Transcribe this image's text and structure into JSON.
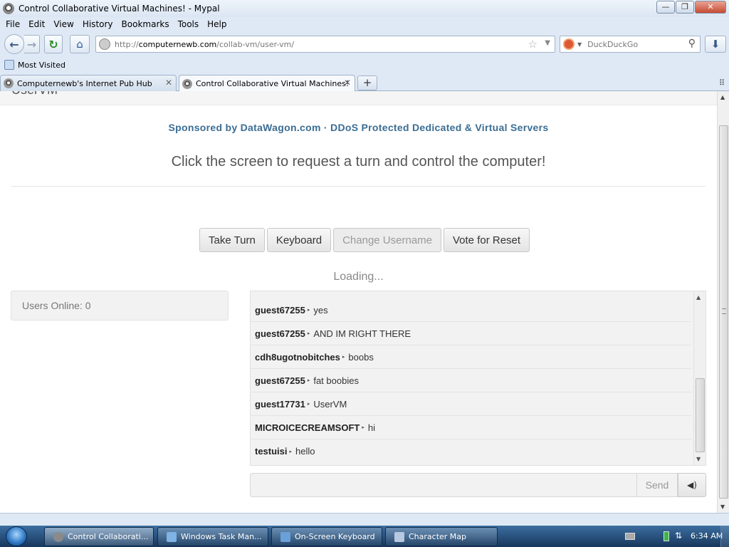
{
  "window": {
    "title": "Control Collaborative Virtual Machines! - Mypal",
    "minimize_glyph": "—",
    "maximize_glyph": "❐",
    "close_glyph": "✕"
  },
  "menu": [
    "File",
    "Edit",
    "View",
    "History",
    "Bookmarks",
    "Tools",
    "Help"
  ],
  "nav": {
    "back_glyph": "←",
    "forward_glyph": "→",
    "reload_glyph": "↻",
    "home_glyph": "⌂",
    "url_prefix": "http://",
    "url_host": "computernewb.com",
    "url_path": "/collab-vm/user-vm/",
    "star_glyph": "☆",
    "dropdown_glyph": "▼",
    "search_placeholder": "DuckDuckGo",
    "search_glyph": "⚲",
    "download_glyph": "⬇"
  },
  "bookmarks": {
    "most_visited": "Most Visited"
  },
  "tabs": [
    {
      "label": "Computernewb's Internet Pub Hub",
      "close": "✕"
    },
    {
      "label": "Control Collaborative Virtual Machines!",
      "close": "✕"
    }
  ],
  "newtab_glyph": "+",
  "tablist_glyph": "⠿",
  "page": {
    "cut_heading": "UserVM",
    "sponsor": "Sponsored by DataWagon.com · DDoS Protected Dedicated & Virtual Servers",
    "prompt": "Click the screen to request a turn and control the computer!",
    "buttons": {
      "take_turn": "Take Turn",
      "keyboard": "Keyboard",
      "change_username": "Change Username",
      "vote_reset": "Vote for Reset"
    },
    "loading": "Loading...",
    "users_online": "Users Online: 0",
    "chat": [
      {
        "user": "guest67255",
        "text": "yes"
      },
      {
        "user": "guest67255",
        "text": "AND IM RIGHT THERE"
      },
      {
        "user": "cdh8ugotnobitches",
        "text": "boobs"
      },
      {
        "user": "guest67255",
        "text": "fat boobies"
      },
      {
        "user": "guest17731",
        "text": "UserVM"
      },
      {
        "user": "MICROICECREAMSOFT",
        "text": "hi"
      },
      {
        "user": "testuisi",
        "text": "hello"
      }
    ],
    "chat_separator": "▸",
    "send": "Send",
    "sound_glyph": "🔊"
  },
  "taskbar": {
    "items": [
      {
        "label": "Control Collaborati...",
        "icon_color": "#8a8a8a"
      },
      {
        "label": "Windows Task Man...",
        "icon_color": "#7fb2e5"
      },
      {
        "label": "On-Screen Keyboard",
        "icon_color": "#6aa0d8"
      },
      {
        "label": "Character Map",
        "icon_color": "#b8c8e0"
      }
    ],
    "clock": "6:34 AM",
    "network_glyph": "⇅"
  }
}
